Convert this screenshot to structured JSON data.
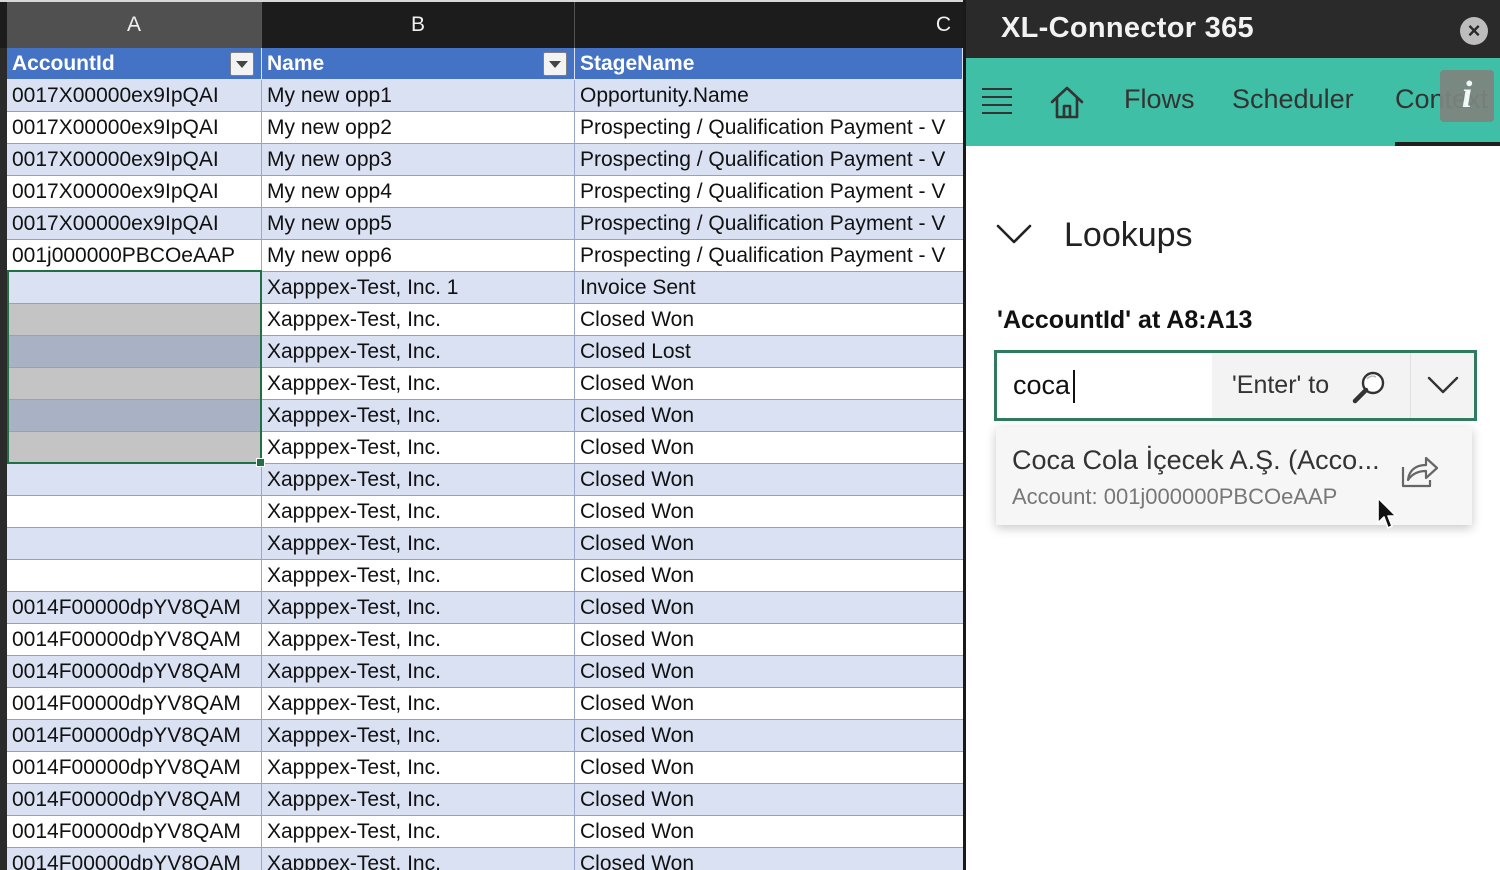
{
  "spreadsheet": {
    "columns": [
      "A",
      "B",
      "C"
    ],
    "headers": [
      "AccountId",
      "Name",
      "StageName"
    ],
    "rows": [
      [
        "0017X00000ex9IpQAI",
        "My new opp1",
        "Opportunity.Name"
      ],
      [
        "0017X00000ex9IpQAI",
        "My new opp2",
        "Prospecting / Qualification Payment - V"
      ],
      [
        "0017X00000ex9IpQAI",
        "My new opp3",
        "Prospecting / Qualification Payment - V"
      ],
      [
        "0017X00000ex9IpQAI",
        "My new opp4",
        "Prospecting / Qualification Payment - V"
      ],
      [
        "0017X00000ex9IpQAI",
        "My new opp5",
        "Prospecting / Qualification Payment - V"
      ],
      [
        "001j000000PBCOeAAP",
        "My new opp6",
        "Prospecting / Qualification Payment - V"
      ],
      [
        "",
        "Xapppex-Test, Inc. 1",
        "Invoice Sent"
      ],
      [
        "",
        "Xapppex-Test, Inc.",
        "Closed Won"
      ],
      [
        "",
        "Xapppex-Test, Inc.",
        "Closed Lost"
      ],
      [
        "",
        "Xapppex-Test, Inc.",
        "Closed Won"
      ],
      [
        "",
        "Xapppex-Test, Inc.",
        "Closed Won"
      ],
      [
        "",
        "Xapppex-Test, Inc.",
        "Closed Won"
      ],
      [
        "",
        "Xapppex-Test, Inc.",
        "Closed Won"
      ],
      [
        "",
        "Xapppex-Test, Inc.",
        "Closed Won"
      ],
      [
        "",
        "Xapppex-Test, Inc.",
        "Closed Won"
      ],
      [
        "",
        "Xapppex-Test, Inc.",
        "Closed Won"
      ],
      [
        "0014F00000dpYV8QAM",
        "Xapppex-Test, Inc.",
        "Closed Won"
      ],
      [
        "0014F00000dpYV8QAM",
        "Xapppex-Test, Inc.",
        "Closed Won"
      ],
      [
        "0014F00000dpYV8QAM",
        "Xapppex-Test, Inc.",
        "Closed Won"
      ],
      [
        "0014F00000dpYV8QAM",
        "Xapppex-Test, Inc.",
        "Closed Won"
      ],
      [
        "0014F00000dpYV8QAM",
        "Xapppex-Test, Inc.",
        "Closed Won"
      ],
      [
        "0014F00000dpYV8QAM",
        "Xapppex-Test, Inc.",
        "Closed Won"
      ],
      [
        "0014F00000dpYV8QAM",
        "Xapppex-Test, Inc.",
        "Closed Won"
      ],
      [
        "0014F00000dpYV8QAM",
        "Xapppex-Test, Inc.",
        "Closed Won"
      ],
      [
        "0014F00000dpYV8QAM",
        "Xapppex-Test, Inc.",
        "Closed Won"
      ]
    ],
    "header_color": "#4472c4",
    "band_color": "#dae1f3",
    "selection_color": "#1f7145"
  },
  "pane": {
    "title": "XL-Connector 365",
    "close_symbol": "×",
    "nav": {
      "flows": "Flows",
      "scheduler": "Scheduler",
      "context": "Context",
      "info_symbol": "i"
    },
    "section_title": "Lookups",
    "range_label": "'AccountId' at A8:A13",
    "search": {
      "value": "coca",
      "hint": "'Enter' to"
    },
    "result": {
      "title": "Coca Cola İçecek A.Ş. (Acco...",
      "subtitle": "Account: 001j000000PBCOeAAP"
    },
    "accent_color": "#3fbfa6",
    "icons": [
      "hamburger-icon",
      "home-icon",
      "chevron-down-icon",
      "search-icon",
      "share-icon",
      "close-icon",
      "info-icon"
    ]
  }
}
